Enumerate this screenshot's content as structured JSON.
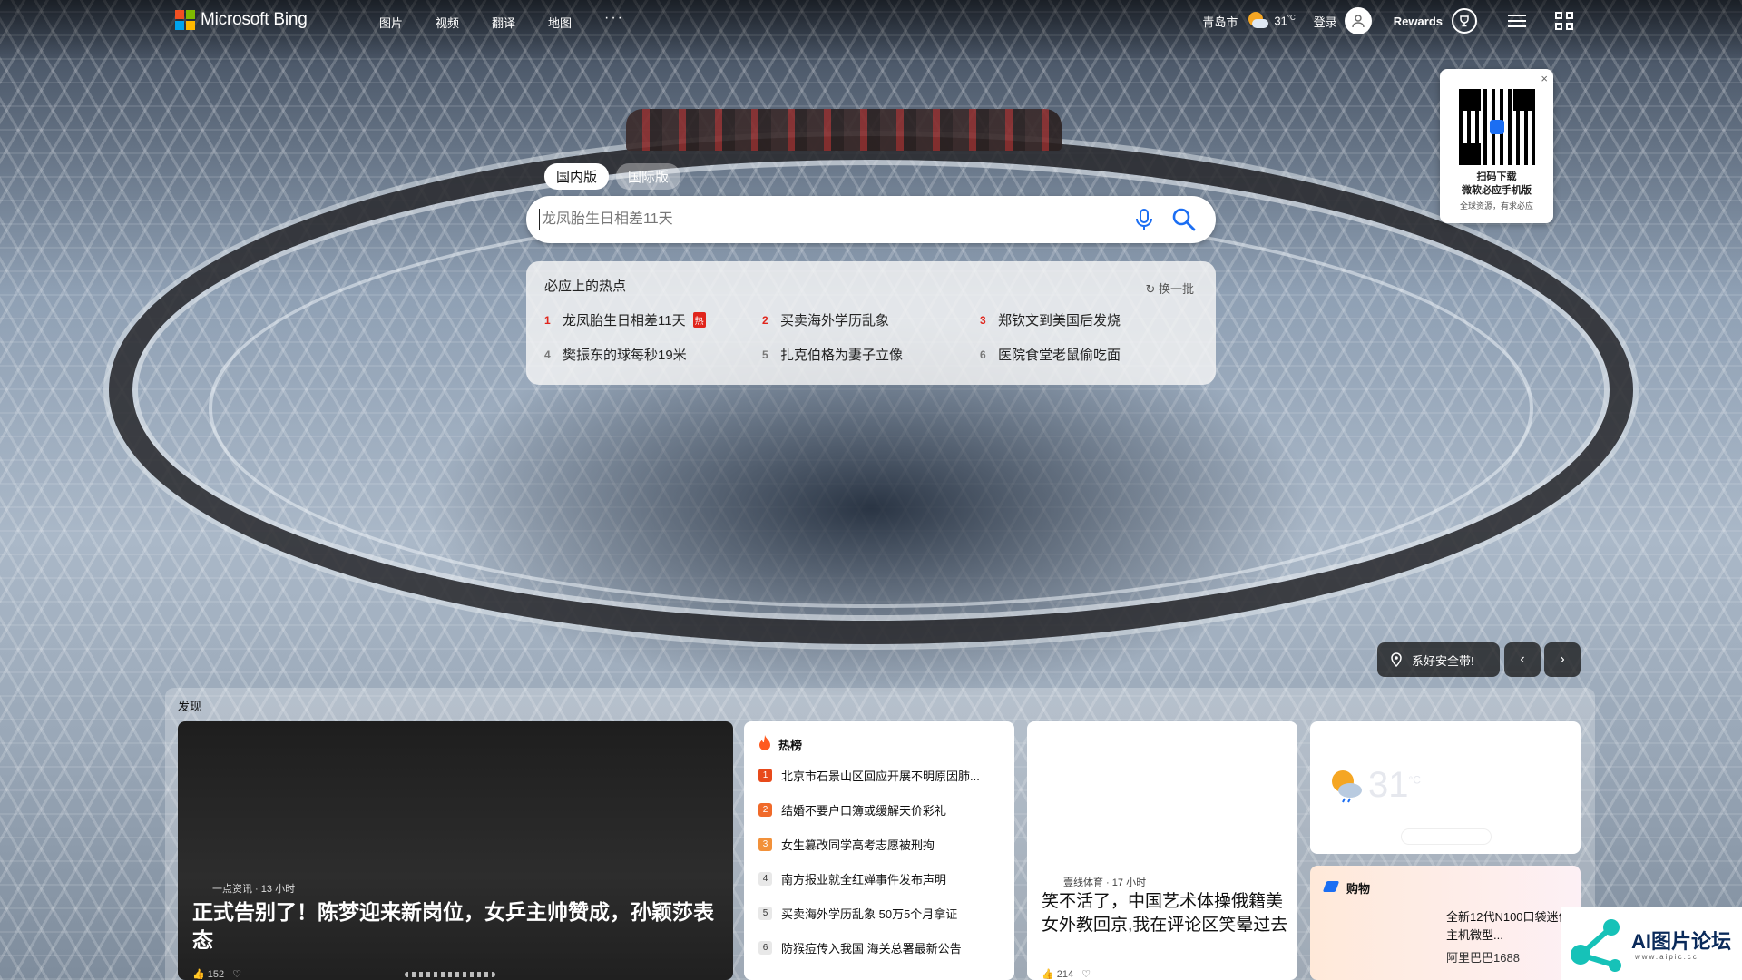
{
  "header": {
    "logo_text": "Microsoft Bing",
    "nav": [
      "图片",
      "视频",
      "翻译",
      "地图"
    ],
    "more": "···",
    "city": "青岛市",
    "temp": "31",
    "temp_unit": "°C",
    "login": "登录",
    "rewards": "Rewards"
  },
  "qr_popup": {
    "close": "×",
    "line1": "扫码下载",
    "line2": "微软必应手机版",
    "line3": "全球资源，有求必应"
  },
  "search": {
    "tabs": [
      "国内版",
      "国际版"
    ],
    "active_tab": "国内版",
    "placeholder": "龙凤胎生日相差11天"
  },
  "hot_panel": {
    "title": "必应上的热点",
    "refresh": "换一批",
    "badge": "热",
    "items": [
      {
        "num": "1",
        "text": "龙凤胎生日相差11天"
      },
      {
        "num": "2",
        "text": "买卖海外学历乱象"
      },
      {
        "num": "3",
        "text": "郑钦文到美国后发烧"
      },
      {
        "num": "4",
        "text": "樊振东的球每秒19米"
      },
      {
        "num": "5",
        "text": "扎克伯格为妻子立像"
      },
      {
        "num": "6",
        "text": "医院食堂老鼠偷吃面"
      }
    ]
  },
  "location": {
    "label": "系好安全带!",
    "prev": "‹",
    "next": "›"
  },
  "discover": {
    "label": "发现",
    "main_card": {
      "source": "一点资讯 · 13 小时",
      "headline": "正式告别了！陈梦迎来新岗位，女乒主帅赞成，孙颖莎表态",
      "likes": "152"
    },
    "hot_card": {
      "title": "热榜",
      "items": [
        {
          "num": "1",
          "text": "北京市石景山区回应开展不明原因肺...",
          "color": "#e84a1b"
        },
        {
          "num": "2",
          "text": "结婚不要户口簿或缓解天价彩礼",
          "color": "#f06a2a"
        },
        {
          "num": "3",
          "text": "女生篡改同学高考志愿被刑拘",
          "color": "#f2913a"
        },
        {
          "num": "4",
          "text": "南方报业就全红婵事件发布声明",
          "color": "#e8e8e8"
        },
        {
          "num": "5",
          "text": "买卖海外学历乱象 50万5个月拿证",
          "color": "#e8e8e8"
        },
        {
          "num": "6",
          "text": "防猴痘传入我国 海关总署最新公告",
          "color": "#e8e8e8"
        }
      ]
    },
    "news_card": {
      "source": "壹线体育 · 17 小时",
      "headline": "笑不活了，中国艺术体操俄籍美女外教回京,我在评论区笑晕过去",
      "likes": "214"
    },
    "weather_card": {
      "temp": "31",
      "unit": "°C"
    },
    "shop_card": {
      "title": "购物",
      "product": "全新12代N100口袋迷你主机微型...",
      "seller": "阿里巴巴1688"
    }
  },
  "watermark": {
    "text": "AI图片论坛",
    "sub": "www.aipic.cc"
  },
  "colors": {
    "accent": "#1b6ef3",
    "hot_red": "#e0241b",
    "ms_red": "#f25022",
    "ms_green": "#7fba00",
    "ms_blue": "#00a4ef",
    "ms_yellow": "#ffb900"
  }
}
